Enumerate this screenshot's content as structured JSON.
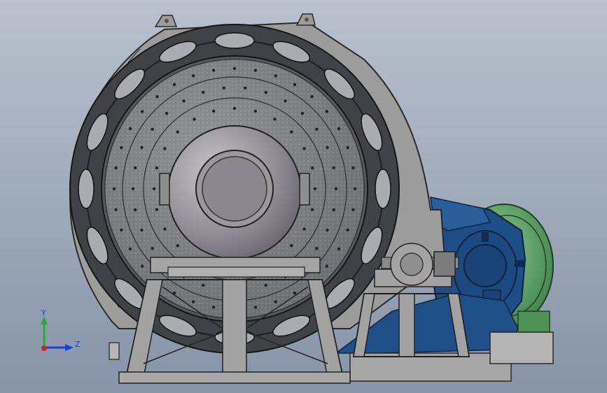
{
  "viewport": {
    "background_top": "#b9c1cd",
    "background_bottom": "#8794a8"
  },
  "model": {
    "colors": {
      "shell": "#9b9b9b",
      "shell_edge": "#2a2a2a",
      "girth_ring": "#3f4347",
      "liner": "#7d7f82",
      "trunnion": "#a3a0a6",
      "base_frame": "#a8a8a8",
      "motor_body": "#1f4e86",
      "motor_edge": "#0d2340",
      "fan_housing": "#5fa56a",
      "fan_edge": "#1f4025",
      "base_plate": "#1e4f86"
    }
  },
  "triad": {
    "y_label": "Y",
    "z_label": "Z",
    "y_color": "#2fa83a",
    "z_color": "#1a3fd6",
    "x_color": "#c0282b"
  }
}
